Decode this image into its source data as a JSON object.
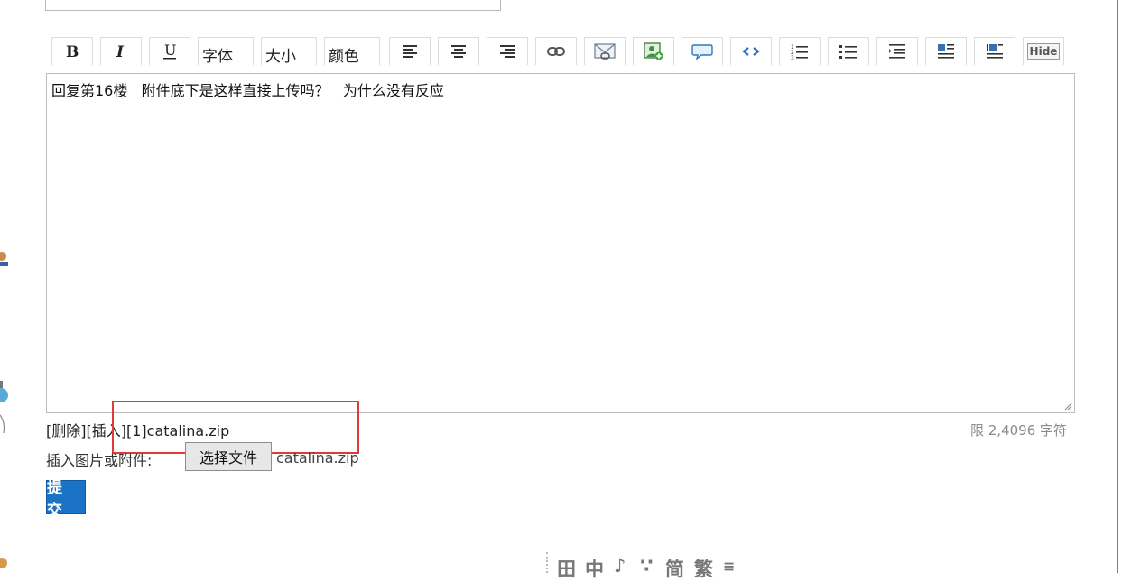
{
  "toolbar": {
    "font_label": "字体",
    "size_label": "大小",
    "color_label": "颜色",
    "hide_label": "Hide",
    "buttons": [
      "bold-icon",
      "italic-icon",
      "underline-icon",
      "align-left-icon",
      "align-center-icon",
      "align-right-icon",
      "link-icon",
      "email-icon",
      "image-icon",
      "quote-icon",
      "code-icon",
      "ordered-list-icon",
      "unordered-list-icon",
      "indent-icon",
      "float-left-icon",
      "float-right-icon",
      "hide-icon"
    ]
  },
  "editor": {
    "content": "回复第16楼   附件底下是这样直接上传吗？   为什么没有反应"
  },
  "attachments": {
    "delete_label": "[删除]",
    "insert_label": "[插入]",
    "file_entry": "[1]catalina.zip",
    "limit_text": "限 2,4096 字符"
  },
  "upload": {
    "label": "插入图片或附件:",
    "button_label": "选择文件",
    "file_name": "catalina.zip"
  },
  "submit_label": "提 交",
  "bottom_icons": [
    "table-icon",
    "chinese-char-icon",
    "music-icon",
    "dots-icon",
    "simplified-icon",
    "traditional-icon"
  ],
  "colors": {
    "accent": "#1a73c7",
    "highlight_border": "#e23a3a",
    "limit_text": "#8a8a8a",
    "right_border": "#3a8ee6"
  }
}
